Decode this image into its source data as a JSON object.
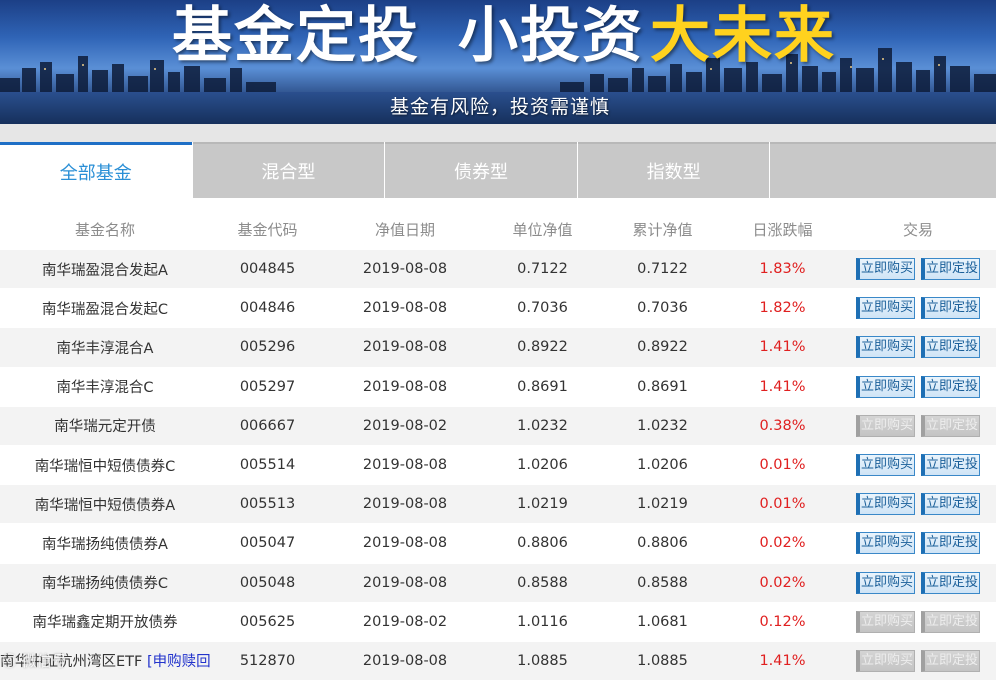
{
  "banner": {
    "title_part1": "基金定投",
    "title_part2": "小投资",
    "title_part3": "大未来",
    "subtitle": "基金有风险，投资需谨慎"
  },
  "tabs": [
    {
      "label": "全部基金",
      "active": true
    },
    {
      "label": "混合型",
      "active": false
    },
    {
      "label": "债券型",
      "active": false
    },
    {
      "label": "指数型",
      "active": false
    }
  ],
  "table": {
    "headers": [
      "基金名称",
      "基金代码",
      "净值日期",
      "单位净值",
      "累计净值",
      "日涨跌幅",
      "交易"
    ],
    "buy_label": "立即购买",
    "plan_label": "立即定投",
    "rows": [
      {
        "name": "南华瑞盈混合发起A",
        "code": "004845",
        "date": "2019-08-08",
        "nav": "0.7122",
        "acc_nav": "0.7122",
        "change": "1.83%",
        "tradable": true
      },
      {
        "name": "南华瑞盈混合发起C",
        "code": "004846",
        "date": "2019-08-08",
        "nav": "0.7036",
        "acc_nav": "0.7036",
        "change": "1.82%",
        "tradable": true
      },
      {
        "name": "南华丰淳混合A",
        "code": "005296",
        "date": "2019-08-08",
        "nav": "0.8922",
        "acc_nav": "0.8922",
        "change": "1.41%",
        "tradable": true
      },
      {
        "name": "南华丰淳混合C",
        "code": "005297",
        "date": "2019-08-08",
        "nav": "0.8691",
        "acc_nav": "0.8691",
        "change": "1.41%",
        "tradable": true
      },
      {
        "name": "南华瑞元定开债",
        "code": "006667",
        "date": "2019-08-02",
        "nav": "1.0232",
        "acc_nav": "1.0232",
        "change": "0.38%",
        "tradable": false
      },
      {
        "name": "南华瑞恒中短债债券C",
        "code": "005514",
        "date": "2019-08-08",
        "nav": "1.0206",
        "acc_nav": "1.0206",
        "change": "0.01%",
        "tradable": true
      },
      {
        "name": "南华瑞恒中短债债券A",
        "code": "005513",
        "date": "2019-08-08",
        "nav": "1.0219",
        "acc_nav": "1.0219",
        "change": "0.01%",
        "tradable": true
      },
      {
        "name": "南华瑞扬纯债债券A",
        "code": "005047",
        "date": "2019-08-08",
        "nav": "0.8806",
        "acc_nav": "0.8806",
        "change": "0.02%",
        "tradable": true
      },
      {
        "name": "南华瑞扬纯债债券C",
        "code": "005048",
        "date": "2019-08-08",
        "nav": "0.8588",
        "acc_nav": "0.8588",
        "change": "0.02%",
        "tradable": true
      },
      {
        "name": "南华瑞鑫定期开放债券",
        "code": "005625",
        "date": "2019-08-02",
        "nav": "1.0116",
        "acc_nav": "1.0681",
        "change": "0.12%",
        "tradable": false
      },
      {
        "name": "南华中证杭州湾区ETF",
        "name_link": "[申购赎回",
        "code": "512870",
        "date": "2019-08-08",
        "nav": "1.0885",
        "acc_nav": "1.0885",
        "change": "1.41%",
        "tradable": false
      }
    ]
  },
  "colors": {
    "accent": "#1e6fc6",
    "positive": "#e02020",
    "tab_inactive": "#c8c8c8"
  }
}
